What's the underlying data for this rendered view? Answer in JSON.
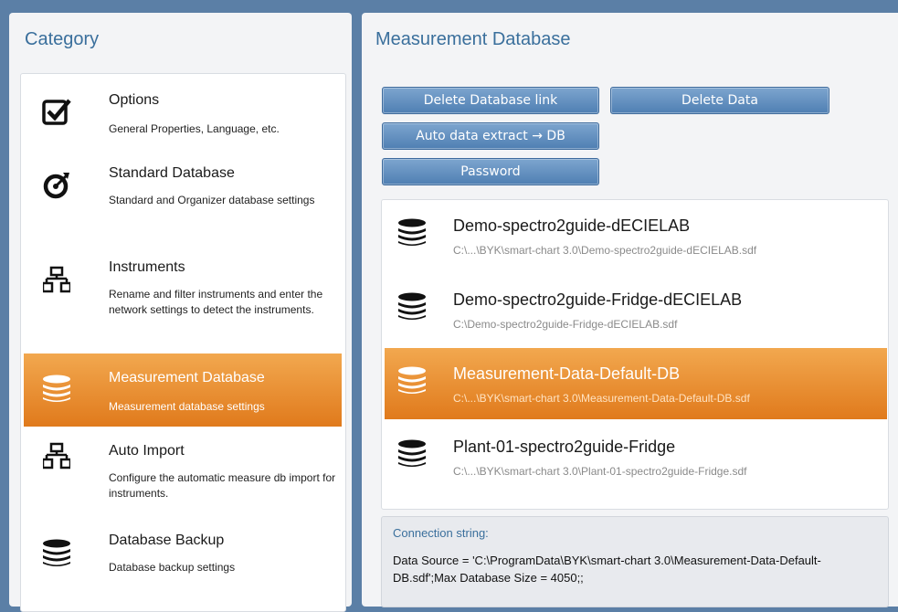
{
  "left": {
    "title": "Category",
    "items": [
      {
        "title": "Options",
        "desc": "General Properties, Language, etc.",
        "icon": "checkbox-icon"
      },
      {
        "title": "Standard Database",
        "desc": "Standard and Organizer database settings",
        "icon": "target-icon"
      },
      {
        "title": "Instruments",
        "desc": "Rename and filter instruments and enter the network settings to detect the instruments.",
        "icon": "network-icon"
      },
      {
        "title": "Measurement Database",
        "desc": "Measurement database settings",
        "icon": "database-icon",
        "selected": true
      },
      {
        "title": "Auto Import",
        "desc": "Configure the automatic measure db import for instruments.",
        "icon": "network-icon"
      },
      {
        "title": "Database Backup",
        "desc": "Database backup settings",
        "icon": "database-icon"
      }
    ]
  },
  "right": {
    "title": "Measurement Database",
    "buttons": {
      "delete_link": "Delete Database link",
      "delete_data": "Delete Data",
      "auto_extract": "Auto data extract → DB",
      "password": "Password"
    },
    "databases": [
      {
        "name": "Demo-spectro2guide-dECIELAB",
        "path": "C:\\...\\BYK\\smart-chart 3.0\\Demo-spectro2guide-dECIELAB.sdf"
      },
      {
        "name": "Demo-spectro2guide-Fridge-dECIELAB",
        "path": "C:\\Demo-spectro2guide-Fridge-dECIELAB.sdf"
      },
      {
        "name": "Measurement-Data-Default-DB",
        "path": "C:\\...\\BYK\\smart-chart 3.0\\Measurement-Data-Default-DB.sdf",
        "selected": true
      },
      {
        "name": "Plant-01-spectro2guide-Fridge",
        "path": "C:\\...\\BYK\\smart-chart 3.0\\Plant-01-spectro2guide-Fridge.sdf"
      }
    ],
    "connection": {
      "label": "Connection string:",
      "value": "Data Source = 'C:\\ProgramData\\BYK\\smart-chart 3.0\\Measurement-Data-Default-DB.sdf';Max Database Size = 4050;;"
    }
  },
  "colors": {
    "accent": "#3a6f9c",
    "selected": "#e88a2a",
    "button": "#5b8ac0"
  }
}
